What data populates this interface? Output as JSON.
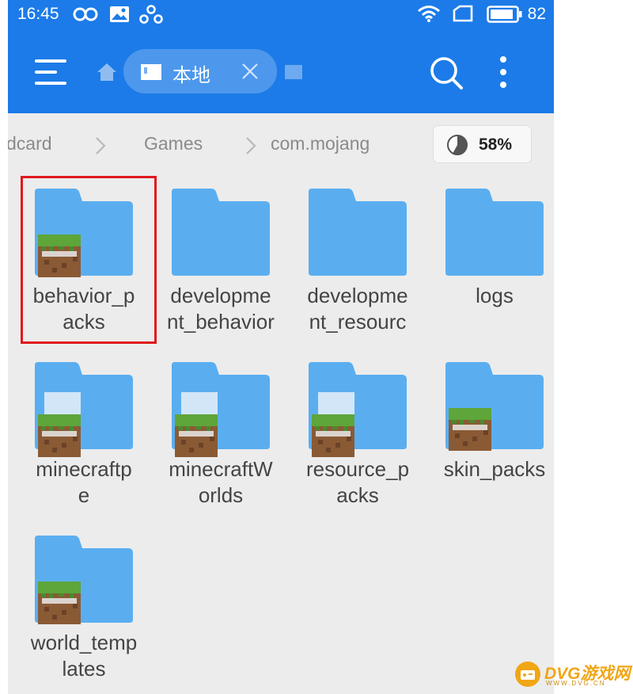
{
  "status_bar": {
    "time": "16:45",
    "battery": "82"
  },
  "header": {
    "tab_label": "本地"
  },
  "breadcrumb": {
    "items": [
      "dcard",
      "Games",
      "com.mojang"
    ]
  },
  "storage": {
    "percent": "58%",
    "used_fraction": 0.58
  },
  "files": [
    {
      "name": "behavior_p\nacks",
      "has_mc_icon": true,
      "doc_layer": false,
      "highlighted": true
    },
    {
      "name": "developme\nnt_behavior",
      "has_mc_icon": false,
      "doc_layer": false,
      "highlighted": false
    },
    {
      "name": "developme\nnt_resourc",
      "has_mc_icon": false,
      "doc_layer": false,
      "highlighted": false
    },
    {
      "name": "logs",
      "has_mc_icon": false,
      "doc_layer": false,
      "highlighted": false
    },
    {
      "name": "minecraftp\ne",
      "has_mc_icon": true,
      "doc_layer": true,
      "highlighted": false
    },
    {
      "name": "minecraftW\norlds",
      "has_mc_icon": true,
      "doc_layer": true,
      "highlighted": false
    },
    {
      "name": "resource_p\nacks",
      "has_mc_icon": true,
      "doc_layer": true,
      "highlighted": false
    },
    {
      "name": "skin_packs",
      "has_mc_icon": true,
      "doc_layer": false,
      "highlighted": false
    },
    {
      "name": "world_temp\nlates",
      "has_mc_icon": true,
      "doc_layer": false,
      "highlighted": false
    }
  ],
  "watermark": {
    "text": "DVG游戏网",
    "sub": "WWW.DVG.CN"
  },
  "colors": {
    "header_blue": "#1c7be8",
    "folder_blue": "#5aaef0",
    "highlight_red": "#e0181c"
  }
}
